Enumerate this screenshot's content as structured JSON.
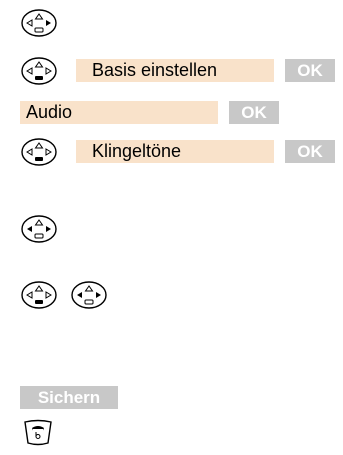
{
  "steps": [
    {
      "type": "control-key",
      "keys": [
        "control-key-down"
      ]
    },
    {
      "type": "menu-select",
      "keys": [
        "control-key-down"
      ],
      "item": "Basis einstellen",
      "softkey": "OK"
    },
    {
      "type": "menu-select",
      "item": "Audio",
      "softkey": "OK"
    },
    {
      "type": "menu-select",
      "keys": [
        "control-key-down"
      ],
      "item": "Klingeltöne",
      "softkey": "OK"
    },
    {
      "type": "control-key",
      "keys": [
        "control-key-left-right"
      ]
    },
    {
      "type": "control-key",
      "keys": [
        "control-key-down",
        "control-key-left-right"
      ]
    },
    {
      "type": "softkey",
      "label": "Sichern"
    },
    {
      "type": "key",
      "keys": [
        "end-call-key"
      ]
    }
  ],
  "colors": {
    "menu_background": "#f9e2ca",
    "softkey_background": "#c8c8c8",
    "softkey_text": "#ffffff"
  }
}
